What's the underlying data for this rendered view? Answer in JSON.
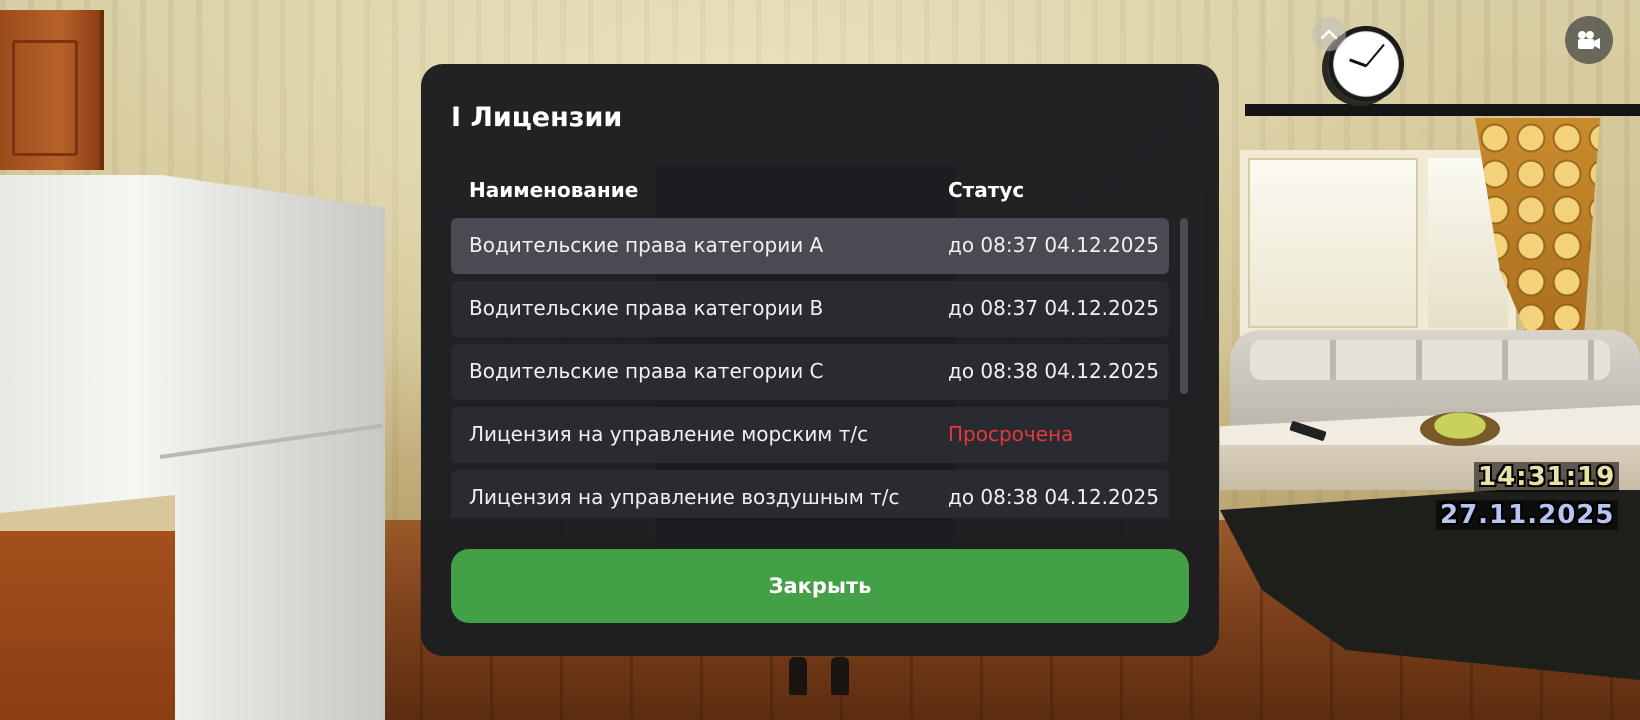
{
  "modal": {
    "title": "I Лицензии",
    "columns": {
      "name": "Наименование",
      "status": "Статус"
    },
    "rows": [
      {
        "name": "Водительские права категории A",
        "status": "до 08:37 04.12.2025",
        "expired": false
      },
      {
        "name": "Водительские права категории B",
        "status": "до 08:37 04.12.2025",
        "expired": false
      },
      {
        "name": "Водительские права категории C",
        "status": "до 08:38 04.12.2025",
        "expired": false
      },
      {
        "name": "Лицензия на управление морским т/с",
        "status": "Просрочена",
        "expired": true
      },
      {
        "name": "Лицензия на управление воздушным т/с",
        "status": "до 08:38 04.12.2025",
        "expired": false
      }
    ],
    "close_label": "Закрыть"
  },
  "hud": {
    "time": "14:31:19",
    "date": "27.11.2025",
    "up_icon": "chevron-up-icon",
    "camera_icon": "video-camera-icon"
  },
  "colors": {
    "panel": "#1e1e22",
    "row": "#2a2b30",
    "row_active": "#4a4b52",
    "accent_green": "#43a047",
    "expired_red": "#e0393e"
  }
}
